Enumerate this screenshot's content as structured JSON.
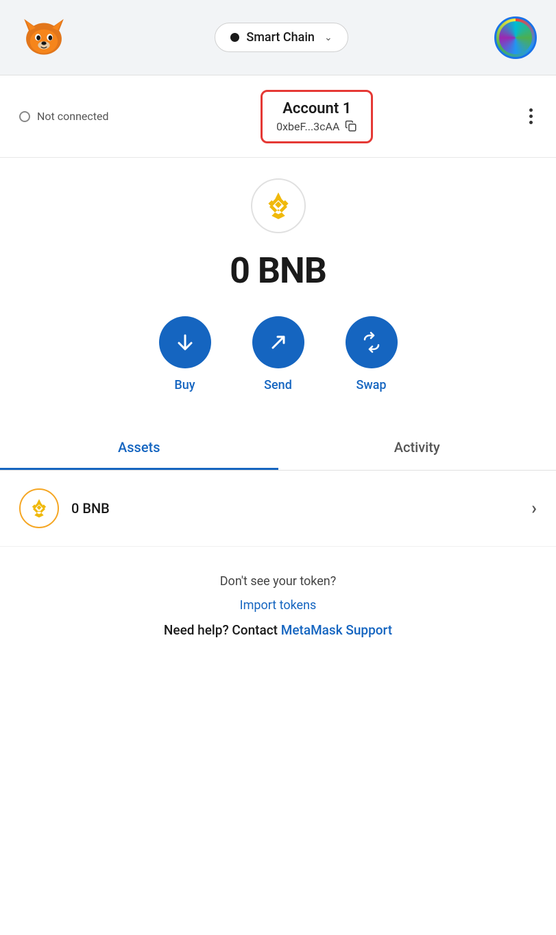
{
  "header": {
    "network": {
      "name": "Smart Chain",
      "dot_color": "#1a1a1a"
    },
    "avatar_label": "User avatar"
  },
  "sub_header": {
    "not_connected_label": "Not connected",
    "account": {
      "name": "Account 1",
      "address": "0xbeF...3cAA",
      "copy_title": "Copy address"
    },
    "menu_label": "More options"
  },
  "main": {
    "balance": "0 BNB",
    "bnb_icon_label": "BNB token icon",
    "actions": [
      {
        "id": "buy",
        "label": "Buy",
        "icon": "↓"
      },
      {
        "id": "send",
        "label": "Send",
        "icon": "↗"
      },
      {
        "id": "swap",
        "label": "Swap",
        "icon": "⇄"
      }
    ],
    "tabs": [
      {
        "id": "assets",
        "label": "Assets",
        "active": true
      },
      {
        "id": "activity",
        "label": "Activity",
        "active": false
      }
    ],
    "assets": [
      {
        "name": "0 BNB",
        "icon_label": "BNB icon"
      }
    ],
    "footer": {
      "no_token_text": "Don't see your token?",
      "import_link": "Import tokens",
      "help_text": "Need help? Contact ",
      "support_link": "MetaMask Support"
    }
  }
}
